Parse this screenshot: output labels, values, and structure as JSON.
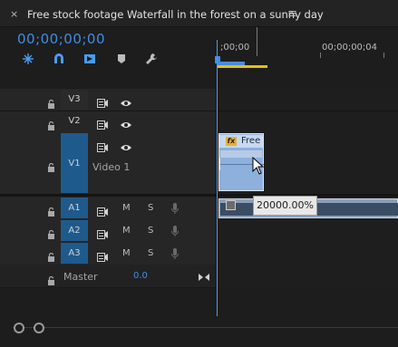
{
  "panel": {
    "close_glyph": "×",
    "title": "Free stock footage Waterfall in the forest on a sunny day",
    "menu_glyph": "≡"
  },
  "timecode": "00;00;00;00",
  "ruler": {
    "start": ";00;00",
    "mark": "00;00;00;04"
  },
  "tools": [
    "snap-icon",
    "magnet-icon",
    "linked-selection-icon",
    "marker-icon",
    "wrench-icon"
  ],
  "tracks": {
    "video": [
      {
        "name": "V3"
      },
      {
        "name": "V2"
      },
      {
        "name": "V1",
        "label": "Video 1"
      }
    ],
    "audio": [
      {
        "name": "A1",
        "m": "M",
        "s": "S"
      },
      {
        "name": "A2",
        "m": "M",
        "s": "S"
      },
      {
        "name": "A3",
        "m": "M",
        "s": "S"
      }
    ],
    "master": {
      "label": "Master",
      "value": "0.0"
    }
  },
  "clip": {
    "fx": "fx",
    "name": "Free"
  },
  "tooltip": "20000.00%",
  "colors": {
    "accent": "#3e8ee8",
    "clip": "#8eb0dc",
    "track_target": "#1f5a8d"
  }
}
